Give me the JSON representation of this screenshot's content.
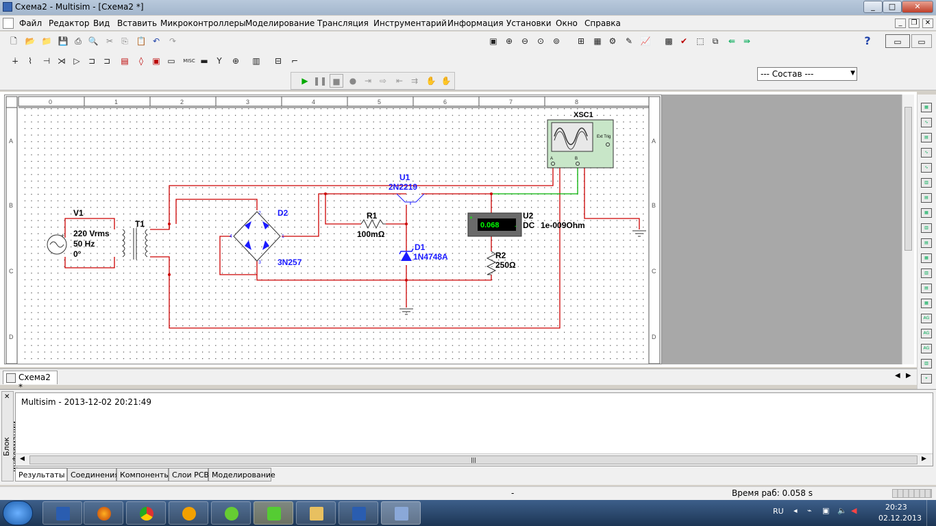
{
  "window": {
    "title": "Схема2 - Multisim - [Схема2 *]",
    "min": "_",
    "max": "□",
    "close": "✕"
  },
  "menu": [
    "Файл",
    "Редактор",
    "Вид",
    "Вставить",
    "Микроконтроллеры",
    "Моделирование",
    "Трансляция",
    "Инструментарий",
    "Информация",
    "Установки",
    "Окно",
    "Справка"
  ],
  "toolbar": {
    "combo": "--- Состав ---",
    "help": "?"
  },
  "circuit": {
    "v1": {
      "name": "V1",
      "l1": "220 Vrms",
      "l2": "50 Hz",
      "l3": "0°"
    },
    "t1": "T1",
    "d2": {
      "name": "D2",
      "part": "3N257"
    },
    "u1": {
      "name": "U1",
      "part": "2N2219"
    },
    "r1": {
      "name": "R1",
      "value": "100mΩ"
    },
    "d1": {
      "name": "D1",
      "part": "1N4748A"
    },
    "u2": {
      "name": "U2",
      "reading": "0.068",
      "mode": "DC",
      "extra": "1e-009Ohm"
    },
    "r2": {
      "name": "R2",
      "value": "250Ω"
    },
    "xsc1": {
      "name": "XSC1",
      "ext": "Ext Trig",
      "a": "A",
      "b": "B"
    },
    "ruler_cols": [
      "0",
      "1",
      "2",
      "3",
      "4",
      "5",
      "6",
      "7",
      "8"
    ],
    "ruler_rows": [
      "A",
      "B",
      "C",
      "D"
    ],
    "pins": {
      "p1": "1",
      "p2": "2",
      "p3": "3",
      "p4": "4"
    }
  },
  "doc_tab": "Схема2 *",
  "info": {
    "side_title": "Блок информации",
    "message": "Multisim  -  2013-12-02 20:21:49"
  },
  "info_tabs": [
    "Результаты",
    "Соединения",
    "Компоненты",
    "Слои PCB",
    "Моделирование"
  ],
  "status": {
    "mid": "-",
    "time": "Время раб: 0.058 s"
  },
  "tray": {
    "lang": "RU",
    "time": "20:23",
    "date": "02.12.2013"
  },
  "colors": {
    "wire": "#cc0000",
    "wire_green": "#00b000",
    "part": "#1a1aff",
    "instrument": "#c8e6c8"
  }
}
